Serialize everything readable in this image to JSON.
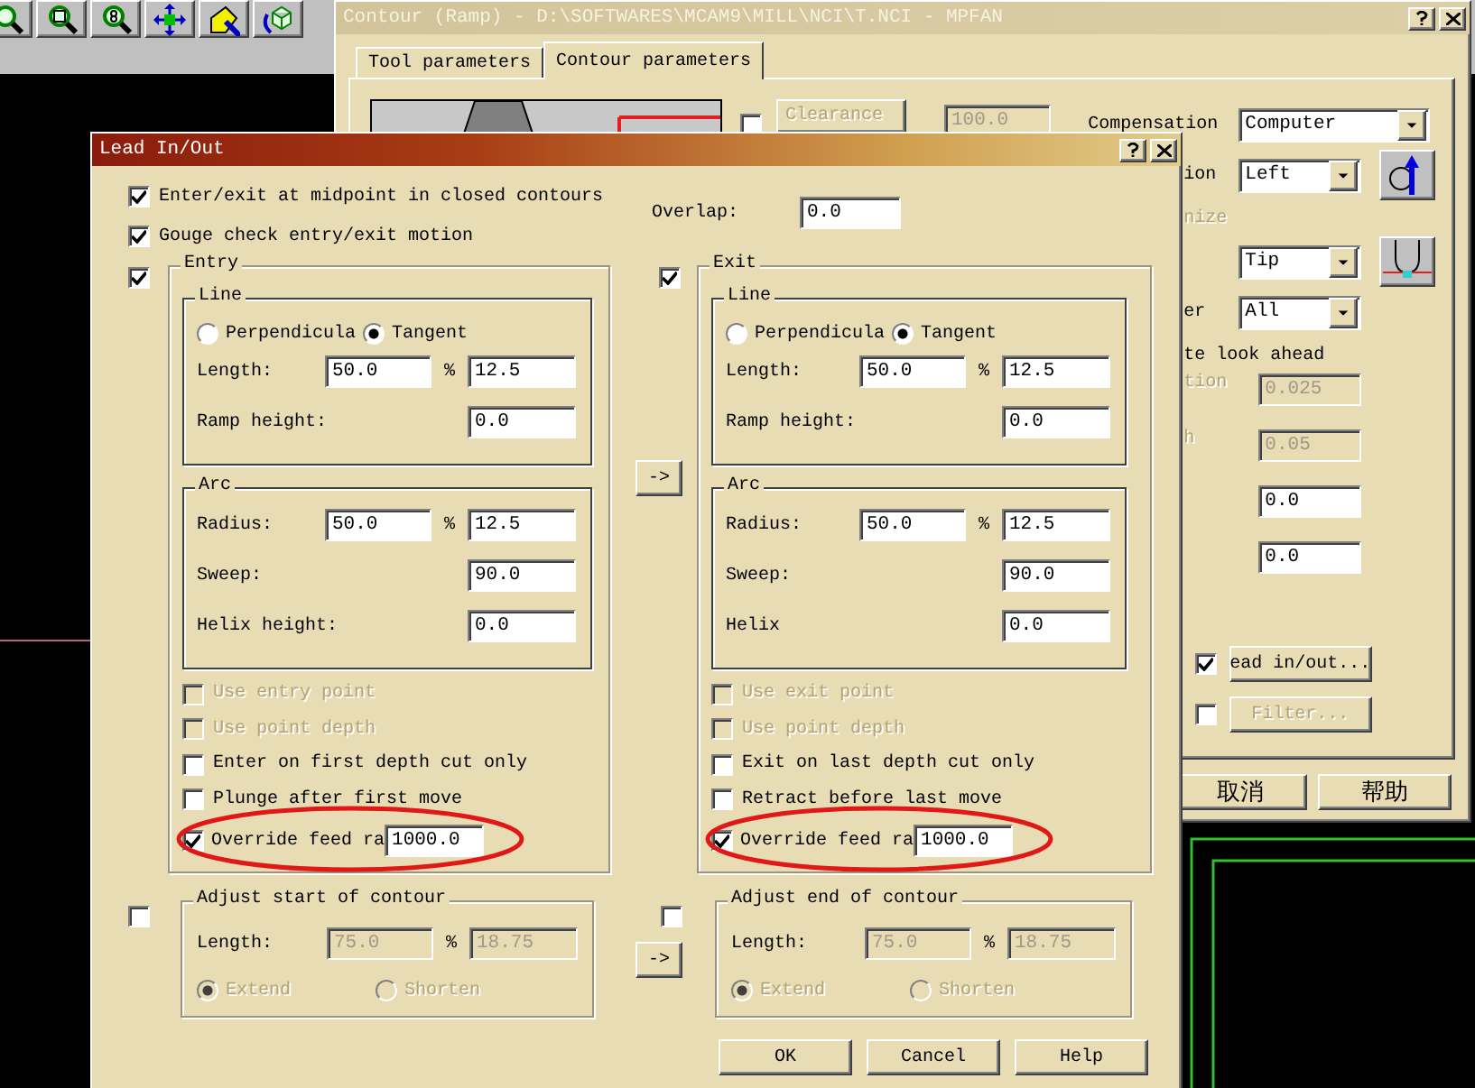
{
  "back_window": {
    "title": "Contour (Ramp) - D:\\SOFTWARES\\MCAM9\\MILL\\NCI\\T.NCI - MPFAN",
    "tabs": [
      {
        "label": "Tool parameters",
        "selected": false
      },
      {
        "label": "Contour parameters",
        "selected": true
      }
    ],
    "clearance": {
      "checked": false,
      "label": "Clearance",
      "value": "100.0",
      "disabled": true
    },
    "rows": [
      {
        "kind": "wide_select",
        "label": "Compensation",
        "value": "Computer"
      },
      {
        "kind": "select_icon",
        "label": "ion",
        "value": "Left"
      },
      {
        "kind": "text",
        "label": "nize",
        "disabled": true
      },
      {
        "kind": "select_icon",
        "value": "Tip"
      },
      {
        "kind": "select",
        "label": "er",
        "value": "All"
      },
      {
        "kind": "text",
        "label": "te look ahead",
        "disabled": false
      },
      {
        "kind": "field",
        "label": "tion",
        "value": "0.025",
        "disabled": true
      },
      {
        "kind": "field",
        "label": "h",
        "value": "0.05",
        "disabled": true
      },
      {
        "kind": "field",
        "value": "0.0",
        "disabled": false
      },
      {
        "kind": "field",
        "value": "0.0",
        "disabled": false
      },
      {
        "kind": "check_button",
        "checked": true,
        "label": "ead in/out...",
        "disabled": false
      },
      {
        "kind": "check_button",
        "checked": false,
        "label": "Filter...",
        "disabled": true
      }
    ],
    "buttons": [
      "取消",
      "帮助"
    ]
  },
  "dialog": {
    "title": "Lead In/Out",
    "options": [
      {
        "label": "Enter/exit at midpoint in closed contours",
        "checked": true
      },
      {
        "label": "Gouge check entry/exit motion",
        "checked": true
      }
    ],
    "overlap": {
      "label": "Overlap:",
      "value": "0.0"
    },
    "sections": [
      {
        "title": "Entry",
        "checked": true,
        "line": {
          "title": "Line",
          "radios": [
            {
              "label": "Perpendicula",
              "selected": false
            },
            {
              "label": "Tangent",
              "selected": true
            }
          ],
          "length_label": "Length:",
          "length_value": "50.0",
          "percent": "%",
          "length_abs": "12.5",
          "ramp_label": "Ramp height:",
          "ramp_value": "0.0"
        },
        "arc": {
          "title": "Arc",
          "radius_label": "Radius:",
          "radius_value": "50.0",
          "percent": "%",
          "radius_abs": "12.5",
          "sweep_label": "Sweep:",
          "sweep_value": "90.0",
          "helix_label": "Helix height:",
          "helix_value": "0.0"
        },
        "options": [
          {
            "label": "Use entry point",
            "checked": false,
            "disabled": true
          },
          {
            "label": "Use point depth",
            "checked": false,
            "disabled": true
          },
          {
            "label": "Enter on first depth cut only",
            "checked": false,
            "disabled": false
          },
          {
            "label": "Plunge after first move",
            "checked": false,
            "disabled": false
          }
        ],
        "override": {
          "label": "Override feed ra",
          "checked": true,
          "value": "1000.0",
          "highlighted": true
        },
        "adjust": {
          "checked": false,
          "title": "Adjust start of contour",
          "length_label": "Length:",
          "value": "75.0",
          "percent": "%",
          "abs": "18.75",
          "disabled": true,
          "radios": [
            {
              "label": "Extend",
              "selected": true
            },
            {
              "label": "Shorten",
              "selected": false
            }
          ]
        }
      },
      {
        "title": "Exit",
        "checked": true,
        "line": {
          "title": "Line",
          "radios": [
            {
              "label": "Perpendicula",
              "selected": false
            },
            {
              "label": "Tangent",
              "selected": true
            }
          ],
          "length_label": "Length:",
          "length_value": "50.0",
          "percent": "%",
          "length_abs": "12.5",
          "ramp_label": "Ramp height:",
          "ramp_value": "0.0"
        },
        "arc": {
          "title": "Arc",
          "radius_label": "Radius:",
          "radius_value": "50.0",
          "percent": "%",
          "radius_abs": "12.5",
          "sweep_label": "Sweep:",
          "sweep_value": "90.0",
          "helix_label": "Helix",
          "helix_value": "0.0"
        },
        "options": [
          {
            "label": "Use exit point",
            "checked": false,
            "disabled": true
          },
          {
            "label": "Use point depth",
            "checked": false,
            "disabled": true
          },
          {
            "label": "Exit on last depth cut only",
            "checked": false,
            "disabled": false
          },
          {
            "label": "Retract before last move",
            "checked": false,
            "disabled": false
          }
        ],
        "override": {
          "label": "Override feed ra",
          "checked": true,
          "value": "1000.0",
          "highlighted": true
        },
        "adjust": {
          "checked": false,
          "title": "Adjust end of contour",
          "length_label": "Length:",
          "value": "75.0",
          "percent": "%",
          "abs": "18.75",
          "disabled": true,
          "radios": [
            {
              "label": "Extend",
              "selected": true
            },
            {
              "label": "Shorten",
              "selected": false
            }
          ]
        }
      }
    ],
    "copy_buttons": [
      "->",
      "->"
    ],
    "buttons": [
      "OK",
      "Cancel",
      "Help"
    ]
  }
}
